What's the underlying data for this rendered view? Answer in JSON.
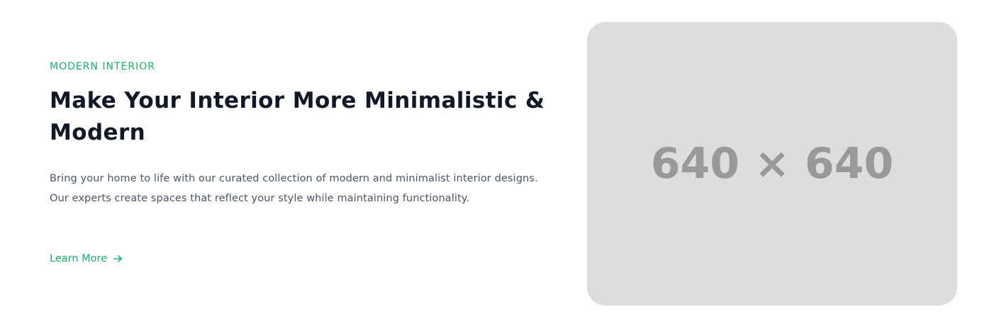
{
  "hero": {
    "eyebrow": "MODERN INTERIOR",
    "title": "Make Your Interior More Minimalistic & Modern",
    "description": "Bring your home to life with our curated collection of modern and minimalist interior designs. Our experts create spaces that reflect your style while maintaining functionality.",
    "cta_label": "Learn More",
    "cta_icon": "arrow-right-icon"
  },
  "image": {
    "placeholder_text": "640 × 640"
  },
  "colors": {
    "accent": "#16b262",
    "heading": "#111827",
    "body": "#4b5563",
    "placeholder_bg": "#dddddd",
    "placeholder_text": "#999999"
  }
}
